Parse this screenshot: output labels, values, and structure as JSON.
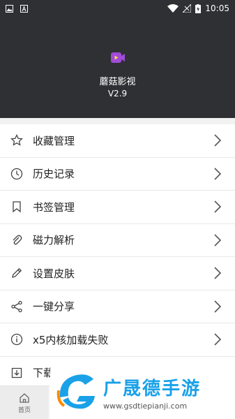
{
  "status_bar": {
    "time": "10:05"
  },
  "header": {
    "app_name": "蘑菇影视",
    "version": "V2.9"
  },
  "menu": {
    "items": [
      {
        "label": "收藏管理",
        "icon": "star-icon"
      },
      {
        "label": "历史记录",
        "icon": "clock-icon"
      },
      {
        "label": "书签管理",
        "icon": "bookmark-icon"
      },
      {
        "label": "磁力解析",
        "icon": "paperclip-icon"
      },
      {
        "label": "设置皮肤",
        "icon": "pencil-icon"
      },
      {
        "label": "一键分享",
        "icon": "share-icon"
      },
      {
        "label": "x5内核加载失败",
        "icon": "info-icon"
      },
      {
        "label": "下载",
        "icon": "download-icon"
      }
    ]
  },
  "bottom_nav": {
    "home_label": "首页"
  },
  "watermark": {
    "title": "广晟德手游",
    "url": "www.gsdtiepianji.com"
  },
  "colors": {
    "header_bg": "#2e3033",
    "logo_purple": "#a24bd8",
    "watermark_blue": "#1aa1e8"
  }
}
